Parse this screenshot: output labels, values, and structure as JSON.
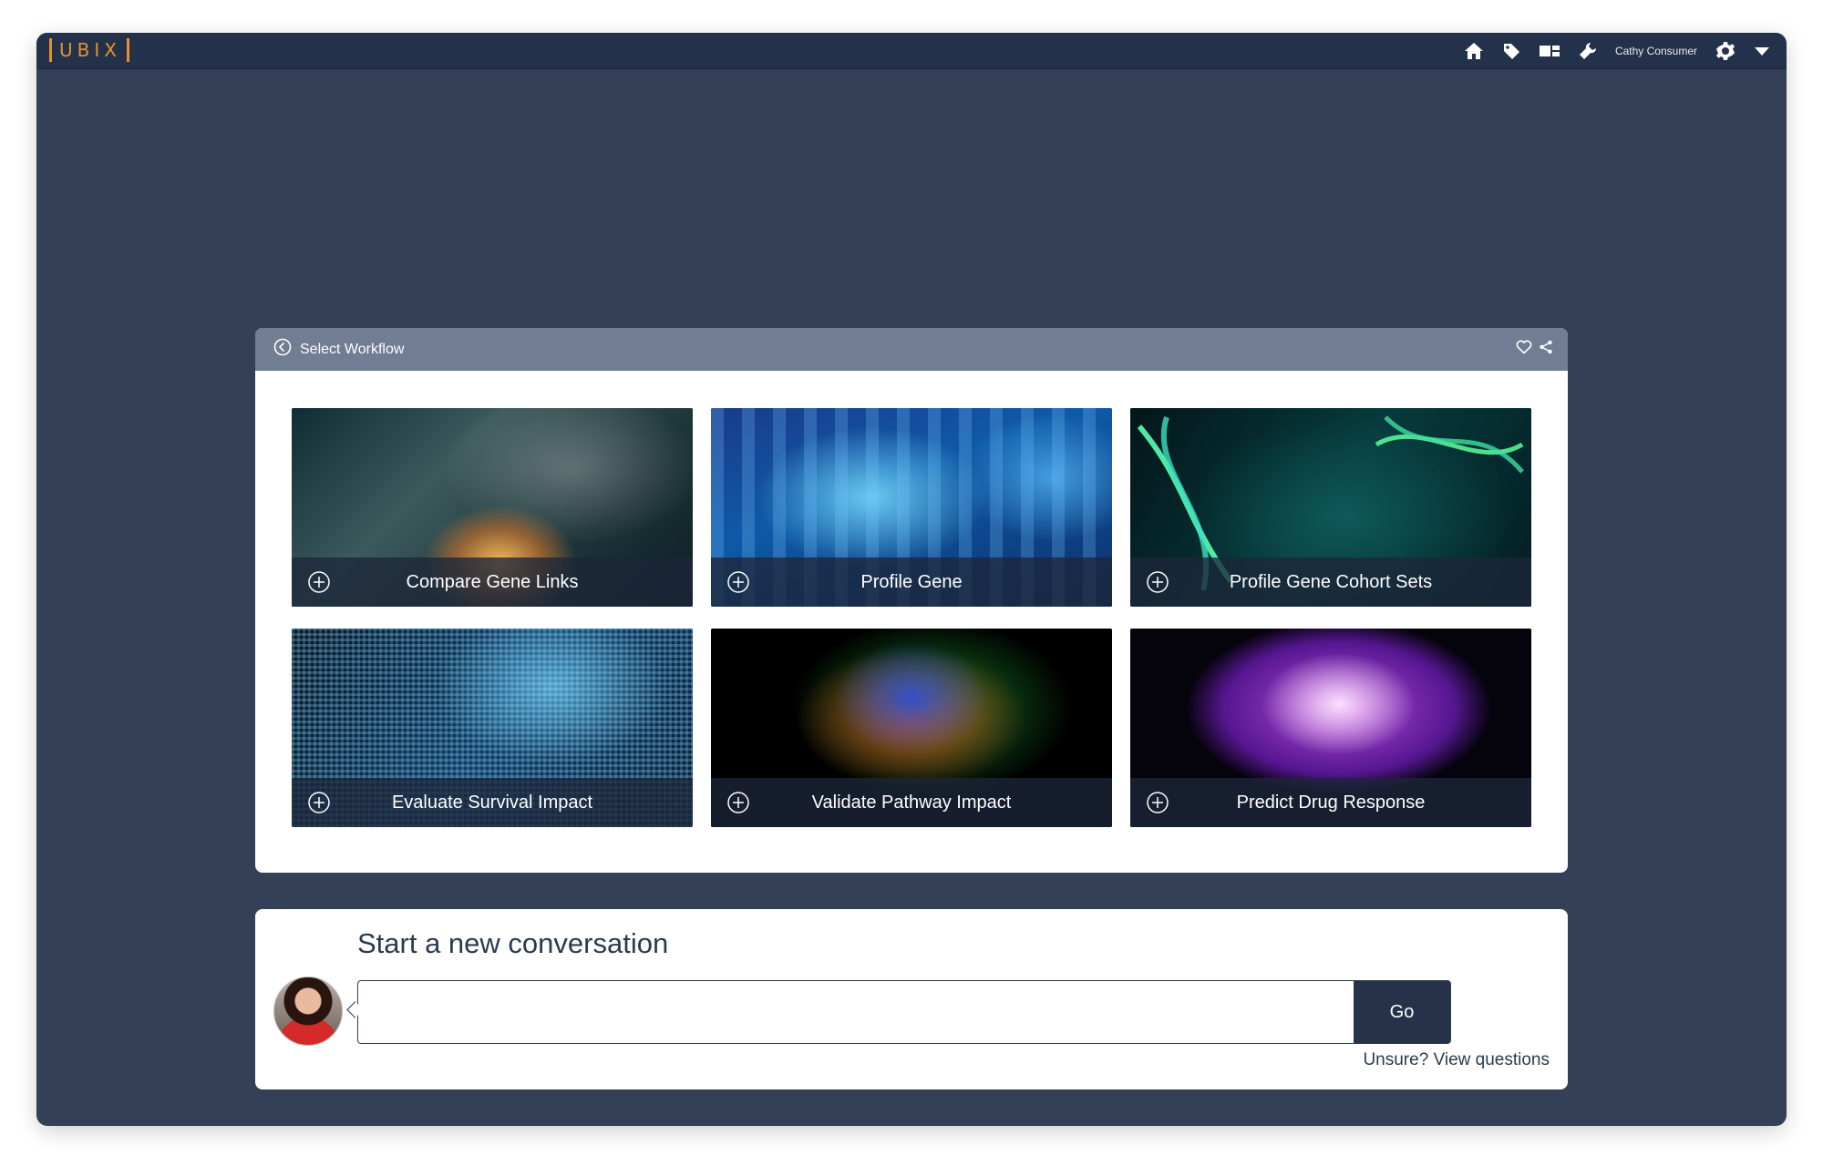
{
  "header": {
    "logo_text": "UBIX",
    "user_name": "Cathy Consumer",
    "icons": [
      "home-icon",
      "tag-icon",
      "dashboard-icon",
      "wrench-icon",
      "gear-icon",
      "caret-down-icon"
    ],
    "accent_color": "#e6922b"
  },
  "workflow_panel": {
    "title": "Select Workflow",
    "tiles": [
      {
        "label": "Compare Gene Links"
      },
      {
        "label": "Profile Gene"
      },
      {
        "label": "Profile Gene Cohort Sets"
      },
      {
        "label": "Evaluate Survival Impact"
      },
      {
        "label": "Validate Pathway Impact"
      },
      {
        "label": "Predict Drug Response"
      }
    ]
  },
  "conversation": {
    "title": "Start a new conversation",
    "input_value": "",
    "go_label": "Go",
    "help_link": "Unsure? View questions"
  }
}
